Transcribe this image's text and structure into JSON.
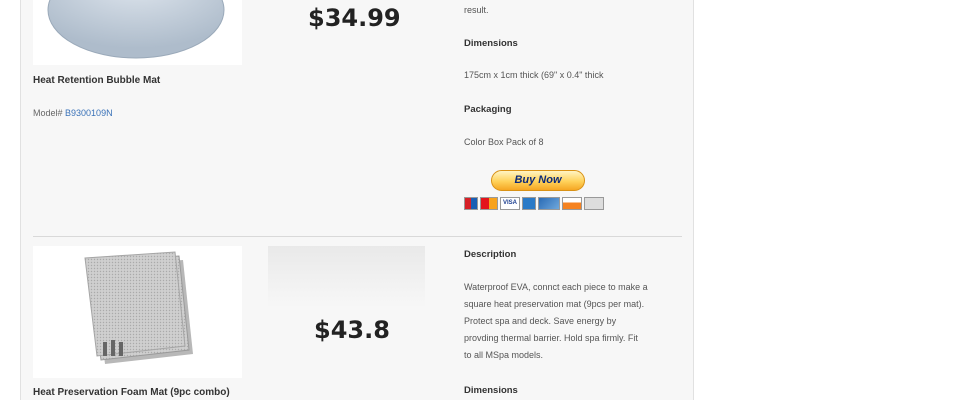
{
  "products": [
    {
      "title": "Heat Retention Bubble Mat",
      "model_prefix": "Model# ",
      "model_link": "B9300109N",
      "price": "$34.99",
      "desc_tail": "result.",
      "dimensions_heading": "Dimensions",
      "dimensions": "175cm x 1cm thick (69\" x 0.4\" thick",
      "packaging_heading": "Packaging",
      "packaging": "Color Box Pack of 8",
      "buy_label": "Buy Now"
    },
    {
      "title": "Heat Preservation Foam Mat (9pc combo)",
      "price": "$43.8",
      "description_heading": "Description",
      "description_lines": [
        "Waterproof EVA, connct each piece to make a",
        "square heat preservation mat (9pcs per mat).",
        "Protect spa and deck. Save energy by",
        "provding thermal barrier. Hold spa firmly. Fit",
        "to all MSpa models."
      ],
      "dimensions_heading": "Dimensions"
    }
  ],
  "payment_cards": [
    "maestro",
    "mastercard",
    "visa",
    "amex",
    "echeck",
    "discover",
    "bank"
  ],
  "colors": {
    "link": "#3a72b8",
    "buy_button": "#ffd25a"
  }
}
